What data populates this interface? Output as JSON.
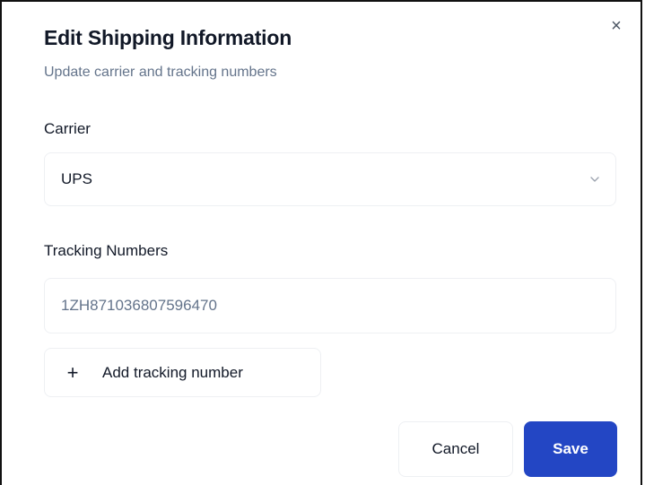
{
  "dialog": {
    "title": "Edit Shipping Information",
    "subtitle": "Update carrier and tracking numbers",
    "close_icon": "close-icon",
    "close_glyph": "×"
  },
  "carrier": {
    "label": "Carrier",
    "selected": "UPS",
    "chevron_icon": "chevron-down-icon"
  },
  "tracking": {
    "label": "Tracking Numbers",
    "values": [
      "1ZH871036807596470"
    ],
    "add_icon": "plus-icon",
    "add_glyph": "+",
    "add_label": "Add tracking number"
  },
  "actions": {
    "cancel_label": "Cancel",
    "save_label": "Save"
  },
  "colors": {
    "primary": "#2346c4",
    "muted_text": "#64748b",
    "border": "#eef0f3"
  }
}
